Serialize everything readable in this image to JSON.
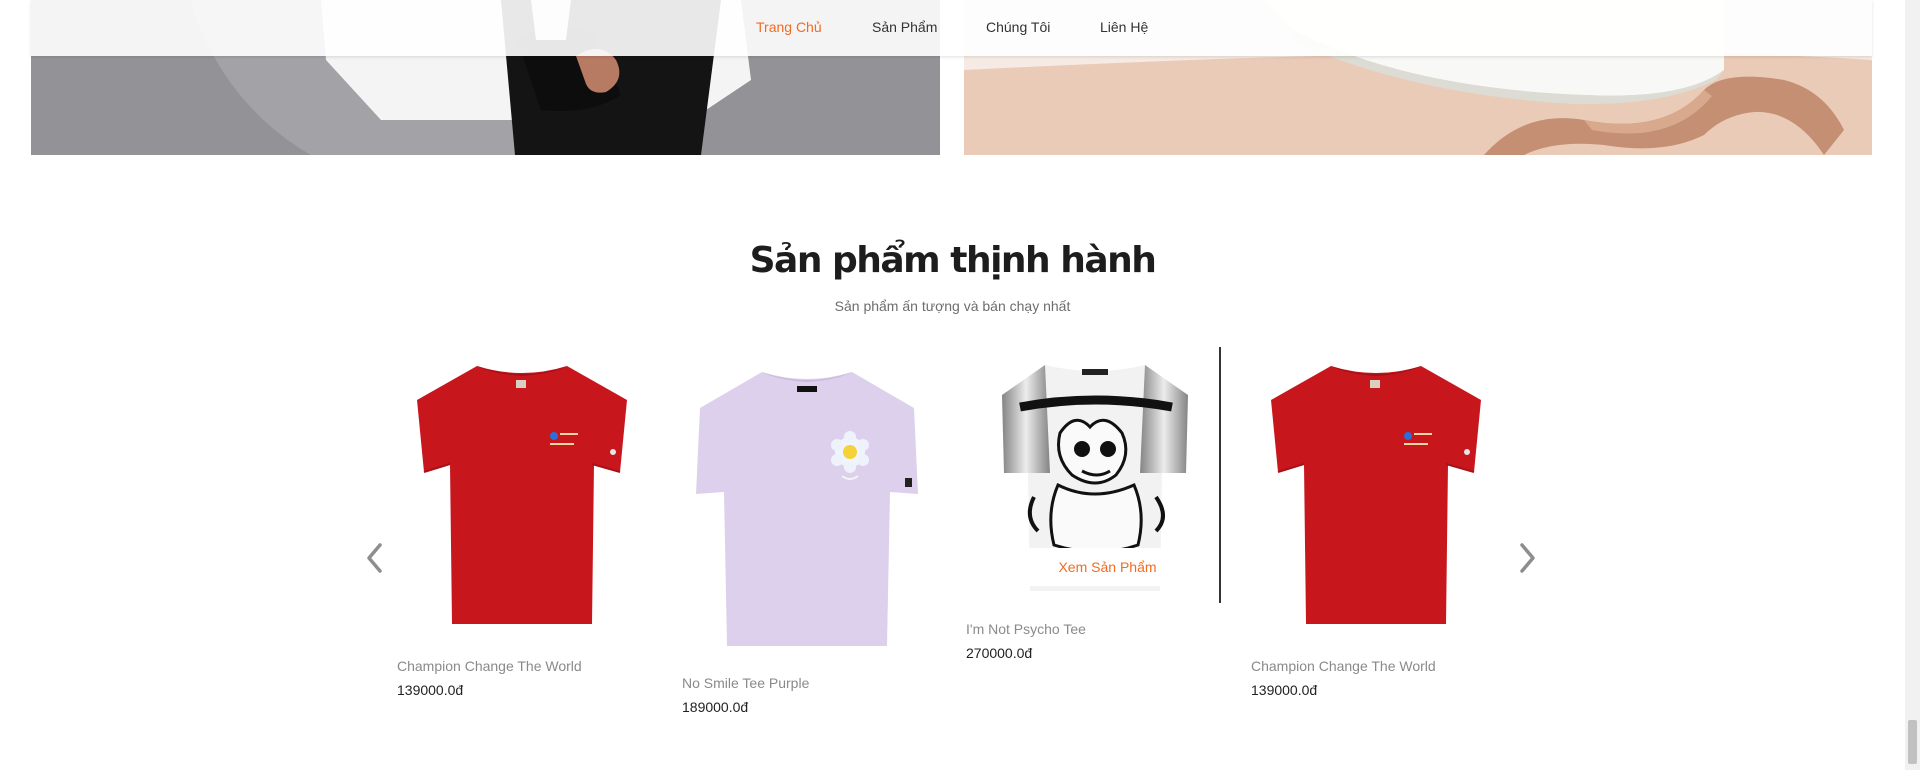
{
  "nav": {
    "items": [
      {
        "label": "Trang Chủ",
        "active": true
      },
      {
        "label": "Sản Phẩm",
        "active": false
      },
      {
        "label": "Chúng Tôi",
        "active": false
      },
      {
        "label": "Liên Hệ",
        "active": false
      }
    ]
  },
  "trending": {
    "title": "Sản phẩm thịnh hành",
    "subtitle": "Sản phẩm ấn tượng và bán chạy nhất",
    "view_button": "Xem Sản Phẩm",
    "products": [
      {
        "name": "Champion Change The World",
        "price": "139000.0đ",
        "image": "red-tshirt"
      },
      {
        "name": "No Smile Tee Purple",
        "price": "189000.0đ",
        "image": "lavender-tshirt-flower"
      },
      {
        "name": "I'm Not Psycho Tee",
        "price": "270000.0đ",
        "image": "three-hundred-tshirt"
      },
      {
        "name": "Champion Change The World",
        "price": "139000.0đ",
        "image": "red-tshirt"
      }
    ]
  },
  "icons": {
    "prev": "chevron-left-icon",
    "next": "chevron-right-icon"
  },
  "colors": {
    "accent": "#f26b21",
    "red_shirt": "#c8161d",
    "lavender_shirt": "#ddd0ec"
  }
}
